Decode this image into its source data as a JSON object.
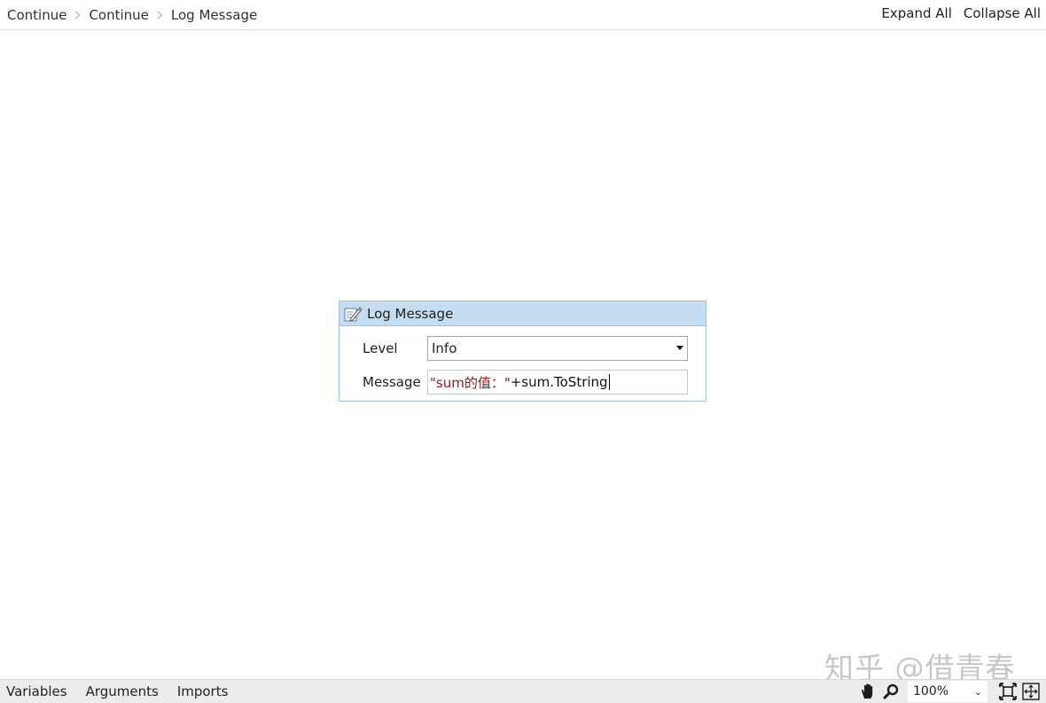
{
  "breadcrumb": [
    {
      "label": "Continue"
    },
    {
      "label": "Continue"
    },
    {
      "label": "Log Message"
    }
  ],
  "header_actions": {
    "expand_all": "Expand All",
    "collapse_all": "Collapse All"
  },
  "activity": {
    "title": "Log Message",
    "icon": "edit-log-icon",
    "level_label": "Level",
    "level_value": "Info",
    "message_label": "Message",
    "message_string": "\"sum的值：\"",
    "message_code": "+sum.ToString"
  },
  "bottom_tabs": {
    "variables": "Variables",
    "arguments": "Arguments",
    "imports": "Imports"
  },
  "zoom": {
    "value": "100%"
  },
  "watermark": "知乎 @借青春",
  "colors": {
    "header_bg": "#c5ddf0",
    "border": "#9cc3e1",
    "string_literal": "#a31515"
  }
}
